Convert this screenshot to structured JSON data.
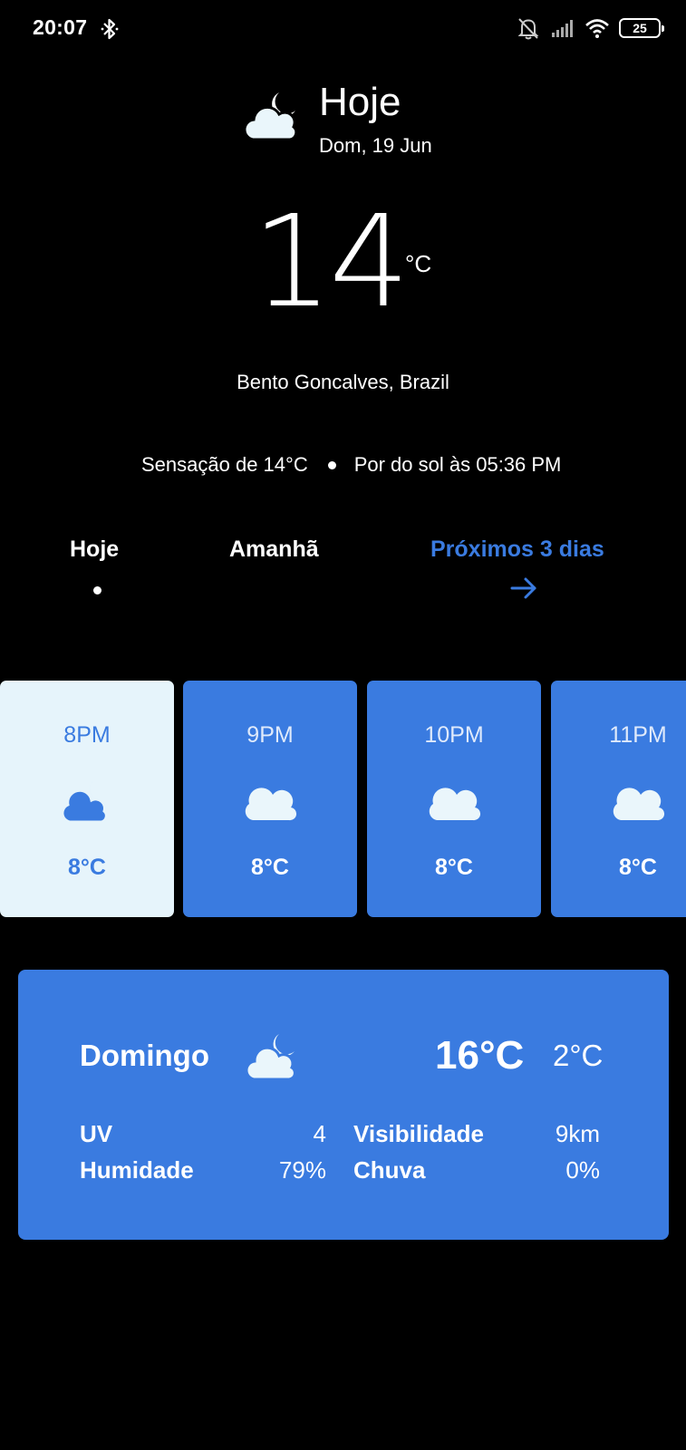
{
  "status_bar": {
    "time": "20:07",
    "battery": "25",
    "icons": [
      "bluetooth-icon",
      "bell-off-icon",
      "signal-icon",
      "wifi-icon",
      "battery-icon"
    ]
  },
  "header": {
    "title": "Hoje",
    "date": "Dom, 19 Jun",
    "icon": "cloudy-night-icon"
  },
  "current": {
    "temperature": "14",
    "unit": "°C",
    "location": "Bento Goncalves, Brazil",
    "feels_like": "Sensação de 14°C",
    "sunset": "Por do sol às 05:36 PM"
  },
  "tabs": {
    "today": "Hoje",
    "tomorrow": "Amanhã",
    "next_days": "Próximos 3 dias"
  },
  "hourly": [
    {
      "time": "8PM",
      "temp": "8°C",
      "icon": "cloudy-night-icon",
      "active": true
    },
    {
      "time": "9PM",
      "temp": "8°C",
      "icon": "cloud-icon",
      "active": false
    },
    {
      "time": "10PM",
      "temp": "8°C",
      "icon": "cloud-icon",
      "active": false
    },
    {
      "time": "11PM",
      "temp": "8°C",
      "icon": "cloud-icon",
      "active": false
    }
  ],
  "day": {
    "name": "Domingo",
    "icon": "cloudy-night-icon",
    "max": "16°C",
    "min": "2°C",
    "stats": {
      "uv_label": "UV",
      "uv_value": "4",
      "humidity_label": "Humidade",
      "humidity_value": "79%",
      "visibility_label": "Visibilidade",
      "visibility_value": "9km",
      "rain_label": "Chuva",
      "rain_value": "0%"
    }
  },
  "colors": {
    "accent": "#3a7be0",
    "active_card": "#e6f4fb",
    "background": "#000000"
  }
}
